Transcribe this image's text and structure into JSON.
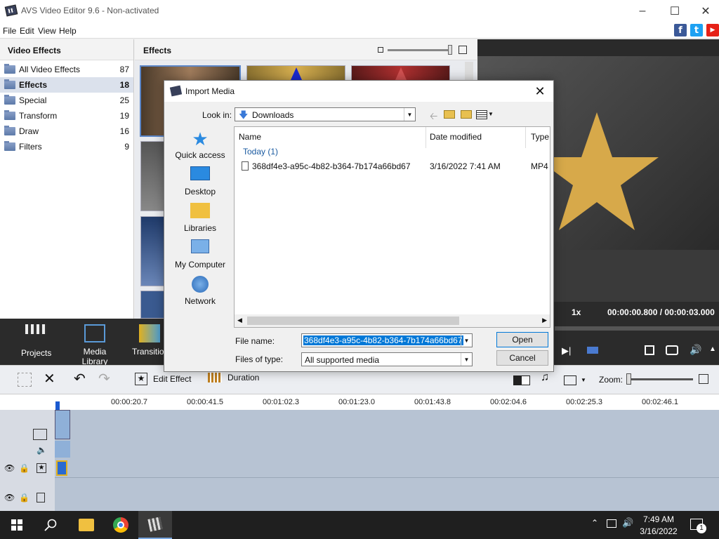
{
  "window": {
    "title": "AVS Video Editor 9.6 - Non-activated"
  },
  "menu": [
    "File",
    "Edit",
    "View",
    "Help"
  ],
  "social": {
    "facebook": "f",
    "twitter": "t",
    "youtube": "▶"
  },
  "left_panel": {
    "title": "Video Effects",
    "categories": [
      {
        "label": "All Video Effects",
        "count": "87"
      },
      {
        "label": "Effects",
        "count": "18"
      },
      {
        "label": "Special",
        "count": "25"
      },
      {
        "label": "Transform",
        "count": "19"
      },
      {
        "label": "Draw",
        "count": "16"
      },
      {
        "label": "Filters",
        "count": "9"
      }
    ]
  },
  "effects_panel": {
    "title": "Effects"
  },
  "nav": {
    "projects": "Projects",
    "media_library": "Media Library",
    "transitions": "Transitions"
  },
  "preview": {
    "speed": "1x",
    "time": "00:00:00.800 / 00:00:03.000"
  },
  "toolbar": {
    "edit_effect": "Edit Effect",
    "duration": "Duration",
    "zoom": "Zoom:"
  },
  "ruler": [
    "00:00:20.7",
    "00:00:41.5",
    "00:01:02.3",
    "00:01:23.0",
    "00:01:43.8",
    "00:02:04.6",
    "00:02:25.3",
    "00:02:46.1"
  ],
  "dialog": {
    "title": "Import Media",
    "look_in_label": "Look in:",
    "look_in_value": "Downloads",
    "places": [
      "Quick access",
      "Desktop",
      "Libraries",
      "My Computer",
      "Network"
    ],
    "columns": {
      "name": "Name",
      "date": "Date modified",
      "type": "Type"
    },
    "group": "Today (1)",
    "file": {
      "name": "368df4e3-a95c-4b82-b364-7b174a66bd67",
      "date": "3/16/2022 7:41 AM",
      "type": "MP4"
    },
    "file_name_label": "File name:",
    "file_name_value": "368df4e3-a95c-4b82-b364-7b174a66bd67",
    "files_of_type_label": "Files of type:",
    "files_of_type_value": "All supported media",
    "open": "Open",
    "cancel": "Cancel"
  },
  "taskbar": {
    "time": "7:49 AM",
    "date": "3/16/2022",
    "notif": "1"
  },
  "colors": {
    "accent": "#0078d7",
    "dark": "#2b2b2b",
    "selection": "#dbe1ec"
  }
}
